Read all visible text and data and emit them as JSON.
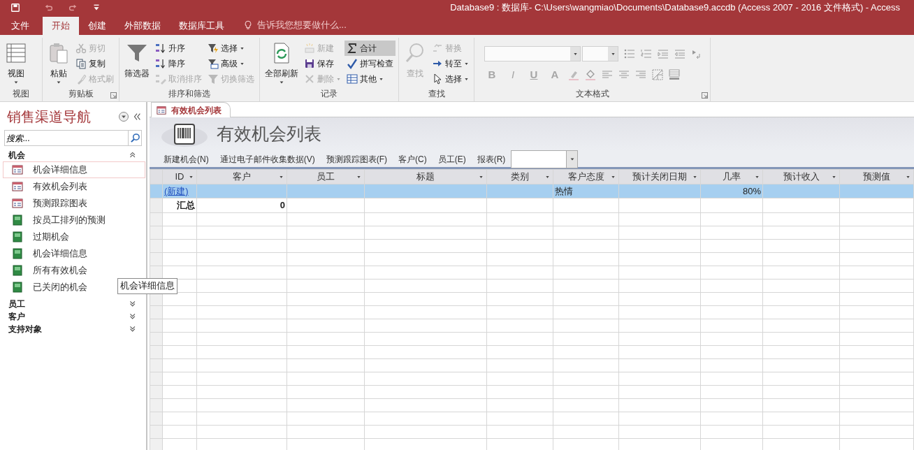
{
  "window": {
    "title": "Database9 : 数据库- C:\\Users\\wangmiao\\Documents\\Database9.accdb (Access 2007 - 2016 文件格式) - Access"
  },
  "ribbon_tabs": [
    {
      "label": "文件",
      "selected": false
    },
    {
      "label": "开始",
      "selected": true
    },
    {
      "label": "创建",
      "selected": false
    },
    {
      "label": "外部数据",
      "selected": false
    },
    {
      "label": "数据库工具",
      "selected": false
    }
  ],
  "tell_me": {
    "placeholder": "告诉我您想要做什么..."
  },
  "ribbon_groups": [
    {
      "label": "视图",
      "kind": "commands",
      "launcher": false,
      "commands": [
        {
          "label": "视图",
          "kind": "large",
          "disabled": false,
          "pressed": false,
          "dropdown": true
        }
      ]
    },
    {
      "label": "剪贴板",
      "kind": "commands",
      "launcher": true,
      "commands": [
        {
          "label": "粘贴",
          "kind": "large",
          "disabled": false,
          "pressed": false,
          "dropdown": true
        },
        {
          "label": "剪切",
          "kind": "small",
          "disabled": true,
          "pressed": false,
          "dropdown": false
        },
        {
          "label": "复制",
          "kind": "small",
          "disabled": false,
          "pressed": false,
          "dropdown": false
        },
        {
          "label": "格式刷",
          "kind": "small",
          "disabled": true,
          "pressed": false,
          "dropdown": false
        }
      ]
    },
    {
      "label": "排序和筛选",
      "kind": "commands",
      "launcher": false,
      "commands": [
        {
          "label": "筛选器",
          "kind": "large",
          "disabled": false,
          "pressed": false,
          "dropdown": false
        },
        {
          "label": "升序",
          "kind": "small",
          "disabled": false,
          "pressed": false,
          "dropdown": false
        },
        {
          "label": "降序",
          "kind": "small",
          "disabled": false,
          "pressed": false,
          "dropdown": false
        },
        {
          "label": "取消排序",
          "kind": "small",
          "disabled": true,
          "pressed": false,
          "dropdown": false
        },
        {
          "label": "选择",
          "kind": "small",
          "disabled": false,
          "pressed": false,
          "dropdown": true
        },
        {
          "label": "高级",
          "kind": "small",
          "disabled": false,
          "pressed": false,
          "dropdown": true
        },
        {
          "label": "切换筛选",
          "kind": "small",
          "disabled": true,
          "pressed": false,
          "dropdown": false
        }
      ]
    },
    {
      "label": "记录",
      "kind": "commands",
      "launcher": false,
      "commands": [
        {
          "label": "全部刷新",
          "kind": "large",
          "disabled": false,
          "pressed": false,
          "dropdown": true
        },
        {
          "label": "新建",
          "kind": "small",
          "disabled": true,
          "pressed": false,
          "dropdown": false
        },
        {
          "label": "保存",
          "kind": "small",
          "disabled": false,
          "pressed": false,
          "dropdown": false
        },
        {
          "label": "删除",
          "kind": "small",
          "disabled": true,
          "pressed": false,
          "dropdown": true
        },
        {
          "label": "合计",
          "kind": "small",
          "disabled": false,
          "pressed": true,
          "dropdown": false
        },
        {
          "label": "拼写检查",
          "kind": "small",
          "disabled": false,
          "pressed": false,
          "dropdown": false
        },
        {
          "label": "其他",
          "kind": "small",
          "disabled": false,
          "pressed": false,
          "dropdown": true
        }
      ]
    },
    {
      "label": "查找",
      "kind": "commands",
      "launcher": false,
      "commands": [
        {
          "label": "查找",
          "kind": "large",
          "disabled": true,
          "pressed": false,
          "dropdown": false
        },
        {
          "label": "替换",
          "kind": "small",
          "disabled": true,
          "pressed": false,
          "dropdown": false
        },
        {
          "label": "转至",
          "kind": "small",
          "disabled": false,
          "pressed": false,
          "dropdown": true
        },
        {
          "label": "选择",
          "kind": "small",
          "disabled": false,
          "pressed": false,
          "dropdown": true
        }
      ]
    },
    {
      "label": "文本格式",
      "kind": "text_format",
      "launcher": true,
      "buttons": [
        {
          "label": "B",
          "disabled": true
        },
        {
          "label": "I",
          "disabled": true
        },
        {
          "label": "U",
          "disabled": true
        },
        {
          "label": "A",
          "disabled": true
        }
      ]
    }
  ],
  "navigation": {
    "title": "销售渠道导航",
    "search": {
      "placeholder": "搜索..."
    },
    "groups": [
      {
        "label": "机会",
        "expanded": true,
        "items": [
          {
            "label": "机会详细信息",
            "kind": "form",
            "highlighted": true
          },
          {
            "label": "有效机会列表",
            "kind": "form",
            "highlighted": false
          },
          {
            "label": "预测跟踪图表",
            "kind": "form",
            "highlighted": false
          },
          {
            "label": "按员工排列的预测",
            "kind": "report",
            "highlighted": false
          },
          {
            "label": "过期机会",
            "kind": "report",
            "highlighted": false
          },
          {
            "label": "机会详细信息",
            "kind": "report",
            "highlighted": false
          },
          {
            "label": "所有有效机会",
            "kind": "report",
            "highlighted": false
          },
          {
            "label": "已关闭的机会",
            "kind": "report",
            "highlighted": false
          }
        ]
      },
      {
        "label": "员工",
        "expanded": false
      },
      {
        "label": "客户",
        "expanded": false
      },
      {
        "label": "支持对象",
        "expanded": false
      }
    ]
  },
  "tooltip": {
    "text": "机会详细信息"
  },
  "document": {
    "tabs": [
      {
        "label": "有效机会列表",
        "selected": true
      }
    ],
    "form_title": "有效机会列表",
    "actions": [
      {
        "label": "新建机会(N)"
      },
      {
        "label": "通过电子邮件收集数据(V)"
      },
      {
        "label": "预测跟踪图表(F)"
      },
      {
        "label": "客户(C)"
      },
      {
        "label": "员工(E)"
      }
    ],
    "report_picker": {
      "label": "报表(R)"
    },
    "table": {
      "columns": [
        {
          "label": "ID"
        },
        {
          "label": "客户"
        },
        {
          "label": "员工"
        },
        {
          "label": "标题"
        },
        {
          "label": "类别"
        },
        {
          "label": "客户态度"
        },
        {
          "label": "预计关闭日期"
        },
        {
          "label": "几率"
        },
        {
          "label": "预计收入"
        },
        {
          "label": "预测值"
        }
      ],
      "rows": [
        {
          "kind": "new",
          "selected": true,
          "cells": [
            "(新建)",
            null,
            null,
            null,
            null,
            "热情",
            null,
            "80%",
            null,
            null
          ]
        },
        {
          "kind": "total",
          "selected": false,
          "cells": [
            "汇总",
            "0",
            null,
            null,
            null,
            null,
            null,
            null,
            null,
            null
          ]
        }
      ]
    }
  }
}
